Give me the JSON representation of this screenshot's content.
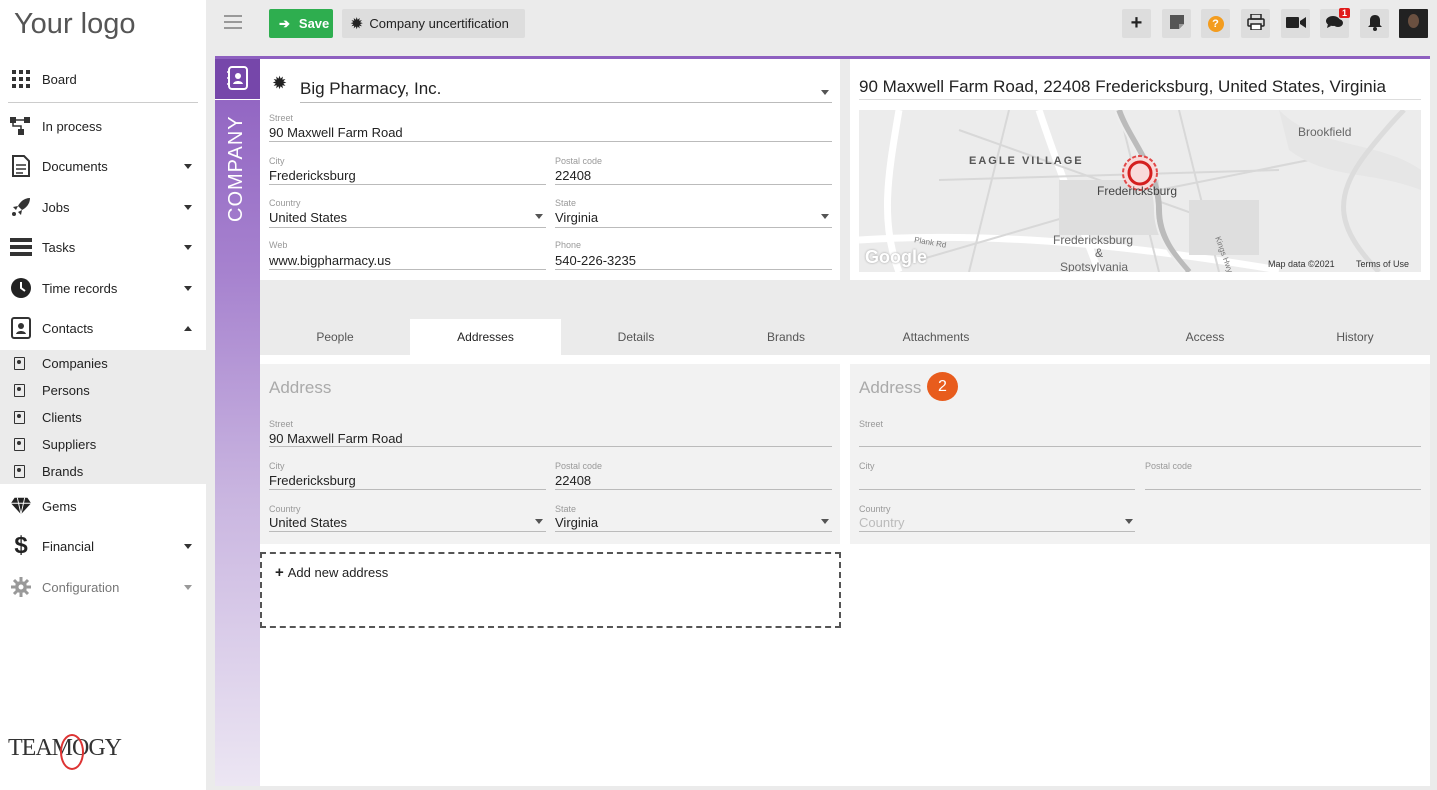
{
  "app": {
    "logo_text": "Your logo",
    "brand_name": "TEAMOGY"
  },
  "sidebar": {
    "items": [
      {
        "label": "Board"
      },
      {
        "label": "In process"
      },
      {
        "label": "Documents"
      },
      {
        "label": "Jobs"
      },
      {
        "label": "Tasks"
      },
      {
        "label": "Time records"
      },
      {
        "label": "Contacts"
      },
      {
        "label": "Gems"
      },
      {
        "label": "Financial"
      },
      {
        "label": "Configuration"
      }
    ],
    "contacts_subitems": [
      {
        "label": "Companies"
      },
      {
        "label": "Persons"
      },
      {
        "label": "Clients"
      },
      {
        "label": "Suppliers"
      },
      {
        "label": "Brands"
      }
    ]
  },
  "toolbar": {
    "save_label": "Save",
    "uncertification_label": "Company uncertification",
    "notification_count": "1",
    "buttons": [
      "plus-icon",
      "note-icon",
      "help-icon",
      "print-icon",
      "video-icon",
      "chat-icon",
      "bell-icon"
    ]
  },
  "company": {
    "section_label": "COMPANY",
    "name": "Big Pharmacy, Inc.",
    "street_label": "Street",
    "street": "90  Maxwell Farm Road",
    "city_label": "City",
    "city": "Fredericksburg",
    "postal_label": "Postal code",
    "postal": "22408",
    "country_label": "Country",
    "country": "United States",
    "state_label": "State",
    "state": "Virginia",
    "web_label": "Web",
    "web": "www.bigpharmacy.us",
    "phone_label": "Phone",
    "phone": "540-226-3235"
  },
  "map": {
    "address": "90 Maxwell Farm Road, 22408 Fredericksburg, United States, Virginia",
    "labels": {
      "brookfield": "Brookfield",
      "eagle_village": "EAGLE VILLAGE",
      "fredericksburg": "Fredericksburg",
      "fred_spotsylvania_1": "Fredericksburg",
      "fred_spotsylvania_2": "&",
      "fred_spotsylvania_3": "Spotsylvania",
      "plank_rd": "Plank Rd",
      "kings_hwy": "Kings Hwy",
      "google": "Google",
      "map_data": "Map data ©2021",
      "terms": "Terms of Use"
    }
  },
  "tabs": [
    {
      "label": "People"
    },
    {
      "label": "Addresses",
      "active": true
    },
    {
      "label": "Details"
    },
    {
      "label": "Brands"
    },
    {
      "label": "Attachments"
    },
    {
      "label": "Access"
    },
    {
      "label": "History"
    }
  ],
  "address1": {
    "title": "Address",
    "street_label": "Street",
    "street": "90  Maxwell Farm Road",
    "city_label": "City",
    "city": "Fredericksburg",
    "postal_label": "Postal code",
    "postal": "22408",
    "country_label": "Country",
    "country": "United States",
    "state_label": "State",
    "state": "Virginia"
  },
  "address2": {
    "title": "Address",
    "badge": "2",
    "street_label": "Street",
    "city_label": "City",
    "postal_label": "Postal code",
    "country_label": "Country",
    "country_placeholder": "Country"
  },
  "add_new_address": "Add new address"
}
